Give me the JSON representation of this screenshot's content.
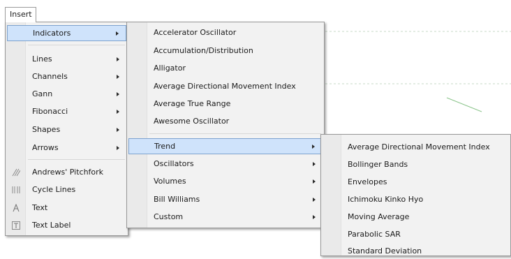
{
  "menubar": {
    "insert_label": "Insert"
  },
  "insert_menu": {
    "items": [
      {
        "label": "Indicators",
        "submenu": true,
        "highlighted": true
      },
      {
        "label": "Lines",
        "submenu": true
      },
      {
        "label": "Channels",
        "submenu": true
      },
      {
        "label": "Gann",
        "submenu": true
      },
      {
        "label": "Fibonacci",
        "submenu": true
      },
      {
        "label": "Shapes",
        "submenu": true
      },
      {
        "label": "Arrows",
        "submenu": true
      },
      {
        "label": "Andrews' Pitchfork",
        "icon": "pitchfork-icon"
      },
      {
        "label": "Cycle Lines",
        "icon": "cycle-lines-icon"
      },
      {
        "label": "Text",
        "icon": "text-icon"
      },
      {
        "label": "Text Label",
        "icon": "text-label-icon"
      }
    ]
  },
  "indicators_menu": {
    "items": [
      {
        "label": "Accelerator Oscillator"
      },
      {
        "label": "Accumulation/Distribution"
      },
      {
        "label": "Alligator"
      },
      {
        "label": "Average Directional Movement Index"
      },
      {
        "label": "Average True Range"
      },
      {
        "label": "Awesome Oscillator"
      },
      {
        "label": "Trend",
        "submenu": true,
        "highlighted": true
      },
      {
        "label": "Oscillators",
        "submenu": true
      },
      {
        "label": "Volumes",
        "submenu": true
      },
      {
        "label": "Bill Williams",
        "submenu": true
      },
      {
        "label": "Custom",
        "submenu": true
      }
    ]
  },
  "trend_menu": {
    "items": [
      {
        "label": "Average Directional Movement Index"
      },
      {
        "label": "Bollinger Bands"
      },
      {
        "label": "Envelopes"
      },
      {
        "label": "Ichimoku Kinko Hyo"
      },
      {
        "label": "Moving Average"
      },
      {
        "label": "Parabolic SAR"
      },
      {
        "label": "Standard Deviation"
      }
    ]
  },
  "colors": {
    "highlight": "#cfe3fb",
    "highlight_border": "#7da2ce",
    "menu_bg": "#f2f2f2"
  }
}
